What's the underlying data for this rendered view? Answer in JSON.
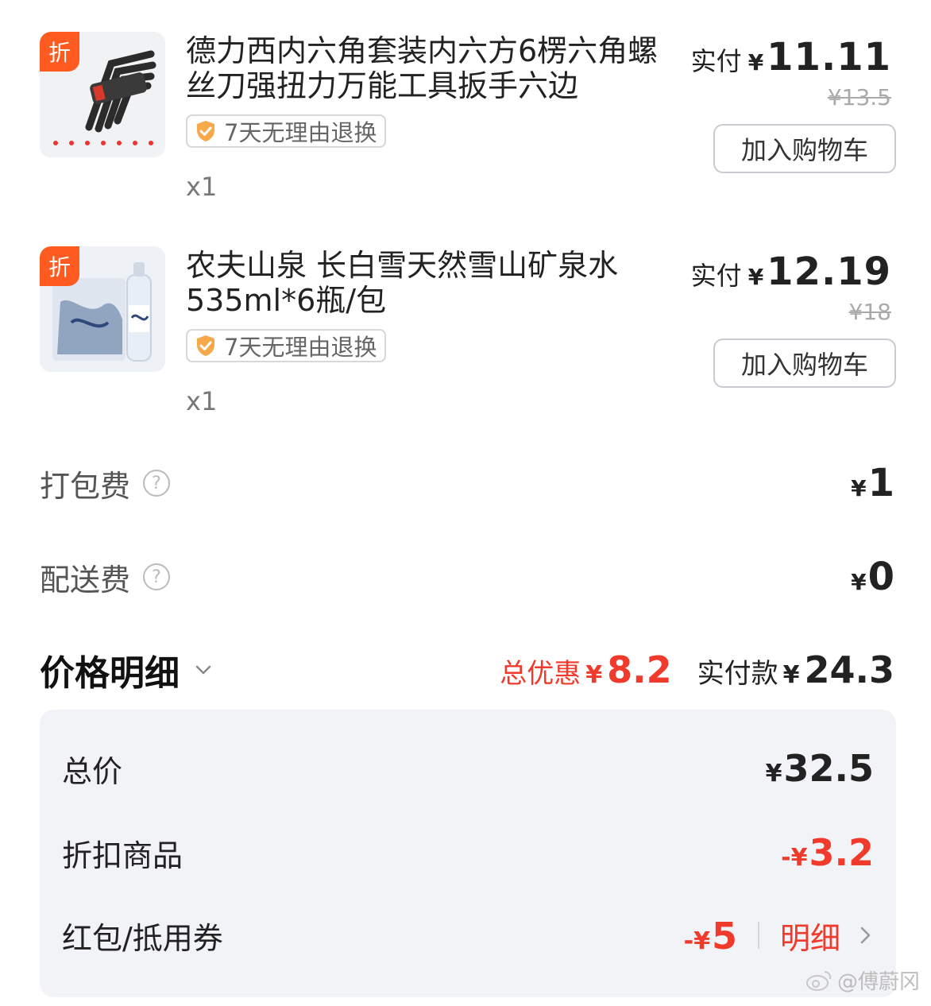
{
  "products": [
    {
      "badge": "折",
      "name": "德力西内六角套装内六方6楞六角螺丝刀强扭力万能工具扳手六边",
      "tag": "7天无理由退换",
      "qty": "x1",
      "paid_label": "实付",
      "currency": "¥",
      "paid_value": "11.11",
      "original_price": "¥13.5",
      "cart_button": "加入购物车"
    },
    {
      "badge": "折",
      "name": "农夫山泉 长白雪天然雪山矿泉水535ml*6瓶/包",
      "tag": "7天无理由退换",
      "qty": "x1",
      "paid_label": "实付",
      "currency": "¥",
      "paid_value": "12.19",
      "original_price": "¥18",
      "cart_button": "加入购物车"
    }
  ],
  "fees": {
    "packing": {
      "label": "打包费",
      "help": "?",
      "currency": "¥",
      "value": "1"
    },
    "delivery": {
      "label": "配送费",
      "help": "?",
      "currency": "¥",
      "value": "0"
    }
  },
  "price_detail": {
    "title": "价格明细",
    "discount_label": "总优惠",
    "discount_currency": "¥",
    "discount_value": "8.2",
    "paid_label": "实付款",
    "paid_currency": "¥",
    "paid_value": "24.3"
  },
  "breakdown": {
    "total": {
      "label": "总价",
      "currency": "¥",
      "value": "32.5"
    },
    "discount_items": {
      "label": "折扣商品",
      "currency": "-¥",
      "value": "3.2"
    },
    "coupon": {
      "label": "红包/抵用券",
      "currency": "-¥",
      "value": "5",
      "link": "明细"
    }
  },
  "watermark": "@傅蔚冈",
  "colors": {
    "accent_red": "#ef3a2c",
    "badge_orange": "#ff5a1f"
  }
}
